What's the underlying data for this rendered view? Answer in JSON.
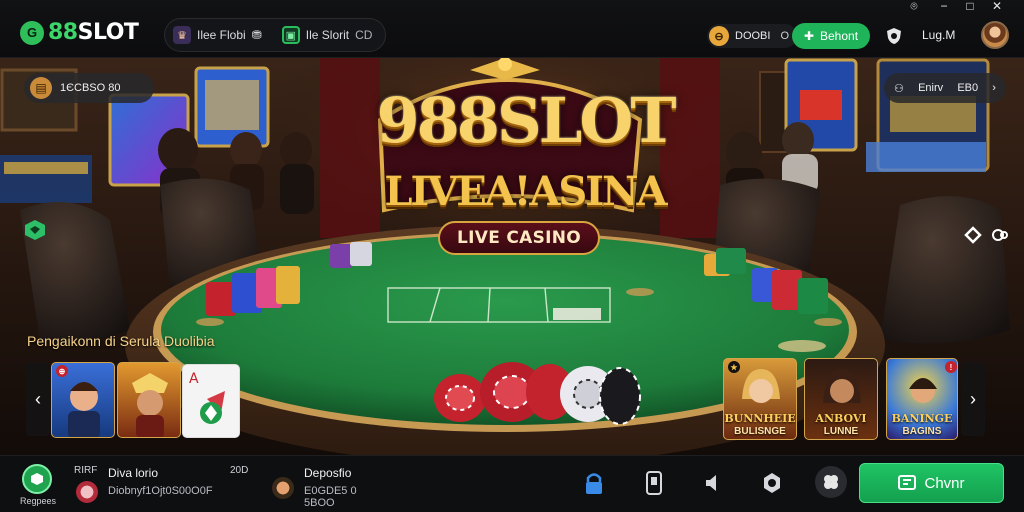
{
  "brand": {
    "badge": "G",
    "name_green": "88",
    "name_white": "SLOT"
  },
  "segments": [
    {
      "label": "Ilee Flobi",
      "suffix": ""
    },
    {
      "label": "Ile Slorit",
      "suffix": "CD"
    }
  ],
  "balance": {
    "amount": "DOOBI",
    "currency": "O"
  },
  "deposit": {
    "label": "Behont"
  },
  "user": {
    "name": "Lug.M"
  },
  "scene": {
    "ping_label": "1ЄCBSO 80",
    "share_label": "Enirv",
    "share_value": "EB0",
    "headline_main": "988SLOT",
    "headline_sub": "LIVEA!ASINA",
    "ribbon": "LIVE CASINO"
  },
  "promo": {
    "title": "Pengaikonn di Serula Duolibia",
    "left_cards": [
      {
        "name": "card-left-1"
      },
      {
        "name": "card-left-2"
      },
      {
        "name": "card-left-3"
      }
    ],
    "right_cards": [
      {
        "title": "BUNNHEIE",
        "caption": "BULISNGE"
      },
      {
        "title": "ANBOVI",
        "caption": "LUNNE"
      },
      {
        "title": "BANINGE",
        "caption": "BAGINS"
      }
    ]
  },
  "bottom": {
    "logo_label": "Regpees",
    "player1": {
      "tag": "RIRF",
      "name": "Diva lorio",
      "detail": "Diobnyf1Ojt0S00O0F"
    },
    "player2": {
      "tag": "20D",
      "name": "Deposfio",
      "detail": "E0GDE5 0 5BOO"
    },
    "chat_label": "Chvnr"
  },
  "colors": {
    "accent_green": "#1fb35a",
    "gold": "#f8d26a",
    "felt": "#1f7a3c"
  }
}
